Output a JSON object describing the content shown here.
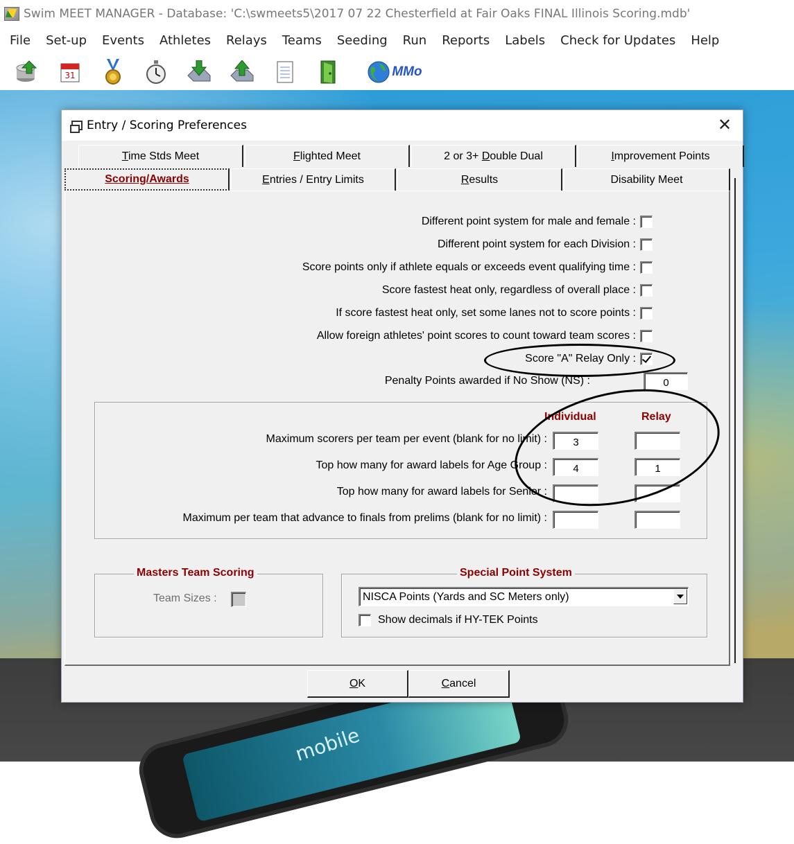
{
  "window": {
    "title": "Swim MEET MANAGER - Database: 'C:\\swmeets5\\2017 07 22 Chesterfield at Fair Oaks FINAL Illinois Scoring.mdb'"
  },
  "menu": [
    "File",
    "Set-up",
    "Events",
    "Athletes",
    "Relays",
    "Teams",
    "Seeding",
    "Run",
    "Reports",
    "Labels",
    "Check for Updates",
    "Help"
  ],
  "toolbar": {
    "icons": [
      "database-export-icon",
      "calendar-icon",
      "medal-icon",
      "stopwatch-icon",
      "import-icon",
      "export-icon",
      "notepad-icon",
      "exit-door-icon",
      "globe-icon"
    ],
    "mmo_label": "MMo"
  },
  "background": {
    "phone_text": "mobile"
  },
  "dialog": {
    "title": "Entry / Scoring Preferences",
    "tabs_row1": [
      {
        "pre": "",
        "key": "T",
        "post": "ime Stds Meet"
      },
      {
        "pre": "",
        "key": "F",
        "post": "lighted Meet"
      },
      {
        "pre": "2 or 3+ ",
        "key": "D",
        "post": "ouble Dual"
      },
      {
        "pre": "",
        "key": "I",
        "post": "mprovement Points"
      }
    ],
    "tabs_row2": [
      {
        "pre": "",
        "key": "S",
        "post": "coring/Awards",
        "active": true
      },
      {
        "pre": "",
        "key": "E",
        "post": "ntries / Entry Limits"
      },
      {
        "pre": "",
        "key": "R",
        "post": "esults"
      },
      {
        "pre": "Disability Meet",
        "key": "",
        "post": ""
      }
    ],
    "options": [
      {
        "label": "Different point system for male and female :",
        "checked": false
      },
      {
        "label": "Different point system for each Division :",
        "checked": false
      },
      {
        "label": "Score points only if athlete equals or exceeds event qualifying time :",
        "checked": false
      },
      {
        "label": "Score fastest heat only, regardless of overall place :",
        "checked": false
      },
      {
        "label": "If score fastest heat only, set some lanes not to score points :",
        "checked": false
      },
      {
        "label": "Allow foreign athletes' point scores to count toward team scores :",
        "checked": false
      },
      {
        "label": "Score \"A\" Relay Only :",
        "checked": true
      }
    ],
    "penalty": {
      "label": "Penalty Points awarded if No Show (NS) :",
      "value": "0"
    },
    "limits": {
      "col_individual": "Individual",
      "col_relay": "Relay",
      "rows": [
        {
          "label": "Maximum scorers per team per event (blank for no limit) :",
          "individual": "3",
          "relay": ""
        },
        {
          "label": "Top how many for award labels for Age Group :",
          "individual": "4",
          "relay": "1"
        },
        {
          "label": "Top how many for award labels for Senior :",
          "individual": "",
          "relay": ""
        },
        {
          "label": "Maximum per team that advance to finals from prelims (blank for no limit) :",
          "individual": "",
          "relay": ""
        }
      ]
    },
    "masters": {
      "title": "Masters Team Scoring",
      "label": "Team Sizes :"
    },
    "special": {
      "title": "Special Point System",
      "selected": "NISCA Points (Yards and SC Meters only)",
      "show_decimals_label": "Show decimals if HY-TEK Points",
      "show_decimals_checked": false
    },
    "buttons": {
      "ok": {
        "key": "O",
        "post": "K"
      },
      "cancel": {
        "key": "C",
        "post": "ancel"
      }
    }
  }
}
